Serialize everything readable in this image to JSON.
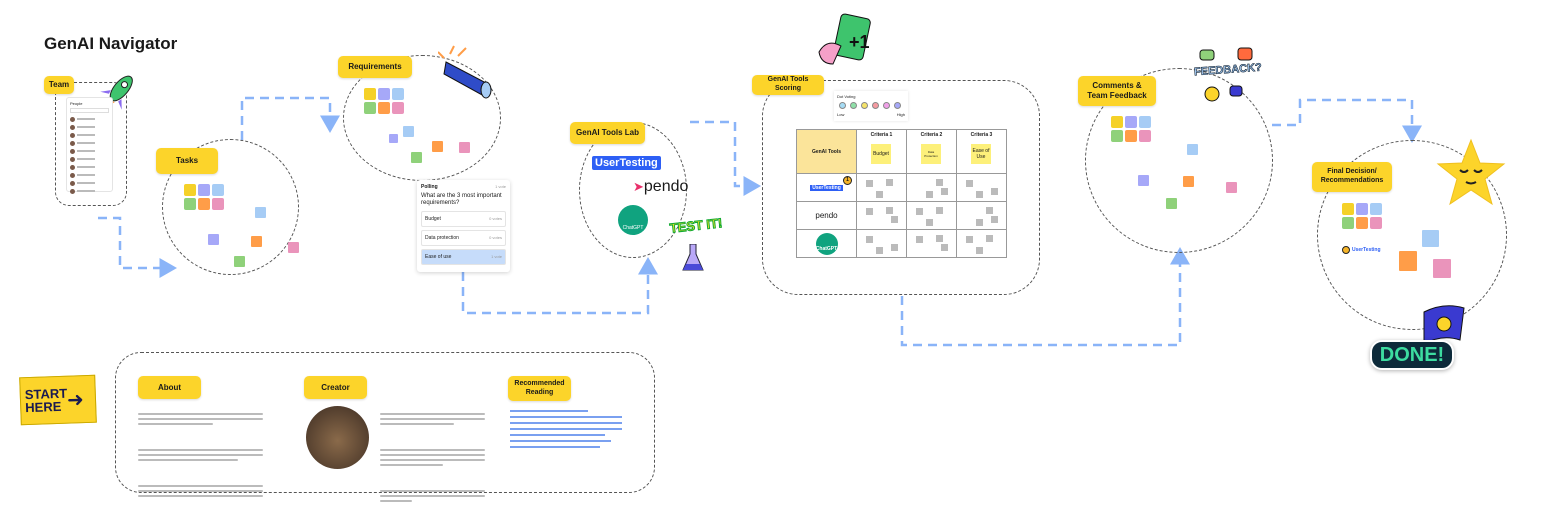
{
  "title": "GenAI Navigator",
  "sections": {
    "team": "Team",
    "tasks": "Tasks",
    "requirements": "Requirements",
    "lab": "GenAI Tools Lab",
    "scoring": "GenAI Tools Scoring",
    "comments": "Comments & Team Feedback",
    "final": "Final Decision/ Recommendations"
  },
  "team_panel": {
    "title": "People"
  },
  "poll": {
    "title": "Polling",
    "votes": "1 vote",
    "question": "What are the 3 most important requirements?",
    "options": [
      {
        "label": "Budget",
        "meta": "0 votes"
      },
      {
        "label": "Data protection",
        "meta": "0 votes"
      },
      {
        "label": "Ease of use",
        "meta": "1 vote",
        "selected": true
      }
    ]
  },
  "tools": {
    "user_testing": "UserTesting",
    "pendo": "pendo",
    "chatgpt": "ChatGPT",
    "test_sticker": "TEST IT!"
  },
  "dot_voting": {
    "title": "Dot Voting",
    "low": "Low",
    "high": "High",
    "colors": [
      "#a6dcf5",
      "#8fe0a8",
      "#f5e36a",
      "#f59aa0",
      "#f0a0e8",
      "#a6a8f8"
    ]
  },
  "scoring_table": {
    "corner": "GenAI Tools",
    "headers": [
      "Criteria 1",
      "Criteria 2",
      "Criteria 3"
    ],
    "header_notes": [
      "Budget",
      "Data Protection",
      "Ease of Use"
    ],
    "rows": [
      "UserTesting",
      "pendo",
      "ChatGPT"
    ],
    "badge": "1"
  },
  "feedback_sticker": "FEEDBACK?",
  "done_sticker": "DONE!",
  "start_sign": "START HERE",
  "bottom": {
    "about": "About",
    "creator": "Creator",
    "reading": "Recommended Reading"
  },
  "colors": {
    "label": "#fcd42a",
    "arrow": "#8ab4f8",
    "yellow": "#f5d128",
    "purple": "#a6a8f8",
    "blue": "#a6ccf5",
    "green": "#8fd17a",
    "orange": "#ff9d48",
    "pink": "#ea94bb"
  }
}
